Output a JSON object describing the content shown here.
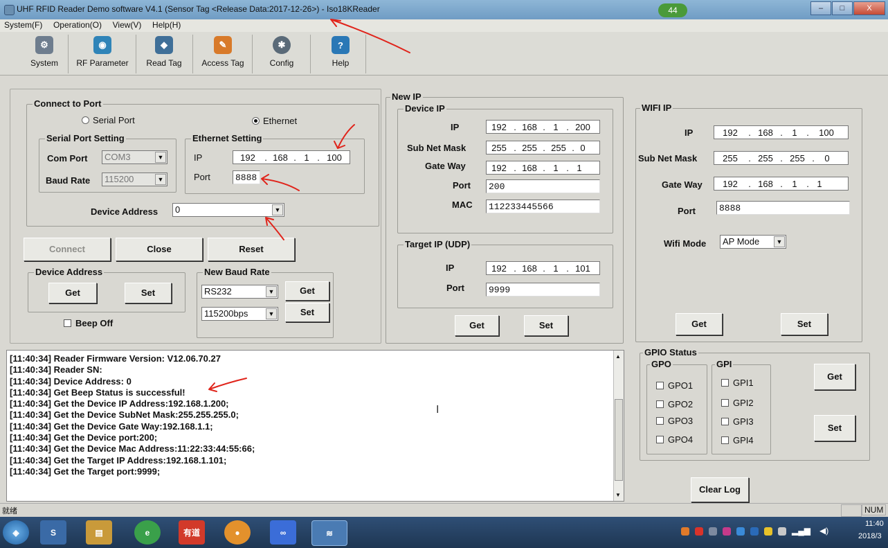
{
  "window": {
    "title": "UHF RFID Reader Demo software V4.1 (Sensor Tag <Release Data:2017-12-26>) - Iso18KReader",
    "badge": "44",
    "min": "–",
    "max": "□",
    "close": "X"
  },
  "menu": [
    "System(F)",
    "Operation(O)",
    "View(V)",
    "Help(H)"
  ],
  "toolbar": [
    "System",
    "RF Parameter",
    "Read Tag",
    "Access Tag",
    "Config",
    "Help"
  ],
  "connect": {
    "title": "Connect to Port",
    "serial_label": "Serial Port",
    "ethernet_label": "Ethernet",
    "serial_setting": {
      "title": "Serial Port Setting",
      "com_label": "Com Port",
      "com_value": "COM3",
      "baud_label": "Baud Rate",
      "baud_value": "115200"
    },
    "ethernet_setting": {
      "title": "Ethernet Setting",
      "ip_label": "IP",
      "ip": [
        "192",
        "168",
        "1",
        "100"
      ],
      "port_label": "Port",
      "port_value": "8888"
    },
    "device_address_label": "Device Address",
    "device_address_value": "0"
  },
  "buttons": {
    "connect": "Connect",
    "close": "Close",
    "reset": "Reset"
  },
  "device_address": {
    "title": "Device Address",
    "get": "Get",
    "set": "Set"
  },
  "beep": {
    "label": "Beep Off"
  },
  "baud": {
    "title": "New Baud Rate",
    "iface": "RS232",
    "rate": "115200bps",
    "get": "Get",
    "set": "Set"
  },
  "newip": {
    "title": "New IP",
    "device": {
      "title": "Device IP",
      "ip_label": "IP",
      "ip": [
        "192",
        "168",
        "1",
        "200"
      ],
      "mask_label": "Sub Net Mask",
      "mask": [
        "255",
        "255",
        "255",
        "0"
      ],
      "gw_label": "Gate Way",
      "gw": [
        "192",
        "168",
        "1",
        "1"
      ],
      "port_label": "Port",
      "port": "200",
      "mac_label": "MAC",
      "mac": "112233445566"
    },
    "target": {
      "title": "Target IP (UDP)",
      "ip_label": "IP",
      "ip": [
        "192",
        "168",
        "1",
        "101"
      ],
      "port_label": "Port",
      "port": "9999"
    },
    "get": "Get",
    "set": "Set"
  },
  "wifi": {
    "title": "WIFI IP",
    "ip_label": "IP",
    "ip": [
      "192",
      "168",
      "1",
      "100"
    ],
    "mask_label": "Sub Net Mask",
    "mask": [
      "255",
      "255",
      "255",
      "0"
    ],
    "gw_label": "Gate Way",
    "gw": [
      "192",
      "168",
      "1",
      "1"
    ],
    "port_label": "Port",
    "port": "8888",
    "mode_label": "Wifi Mode",
    "mode": "AP Mode",
    "get": "Get",
    "set": "Set"
  },
  "gpio": {
    "title": "GPIO Status",
    "gpo_title": "GPO",
    "gpi_title": "GPI",
    "gpo": [
      "GPO1",
      "GPO2",
      "GPO3",
      "GPO4"
    ],
    "gpi": [
      "GPI1",
      "GPI2",
      "GPI3",
      "GPI4"
    ],
    "get": "Get",
    "set": "Set"
  },
  "clear_log": "Clear Log",
  "log": [
    "[11:40:34] Reader Firmware Version: V12.06.70.27",
    "[11:40:34] Reader SN:",
    "[11:40:34] Device Address: 0",
    "[11:40:34] Get Beep Status is successful!",
    "[11:40:34] Get the Device IP Address:192.168.1.200;",
    "[11:40:34] Get the Device SubNet Mask:255.255.255.0;",
    "[11:40:34] Get the Device Gate Way:192.168.1.1;",
    "[11:40:34] Get the Device port:200;",
    "[11:40:34] Get the Device Mac Address:11:22:33:44:55:66;",
    "[11:40:34] Get the Target IP Address:192.168.1.101;",
    "[11:40:34] Get the Target port:9999;"
  ],
  "status": {
    "left": "就绪",
    "num": "NUM"
  },
  "taskbar": {
    "youdao": "有道",
    "time": "11:40",
    "date": "2018/3"
  },
  "colors": {
    "annotation": "#e0241b",
    "titlebar": "#7ea8cc",
    "taskbar": "#23405f"
  }
}
